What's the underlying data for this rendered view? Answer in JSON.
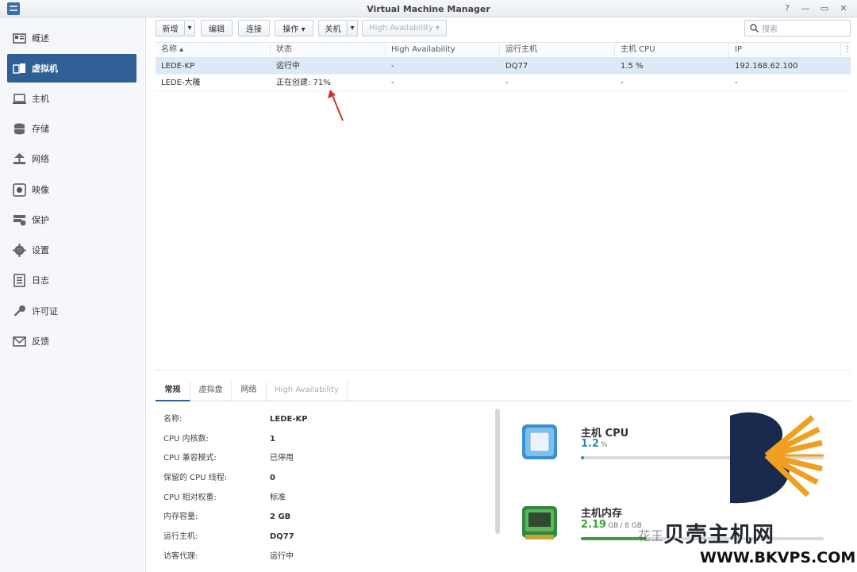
{
  "window": {
    "title": "Virtual Machine Manager"
  },
  "sidebar": {
    "items": [
      {
        "label": "概述",
        "icon": "overview-icon"
      },
      {
        "label": "虚拟机",
        "icon": "vm-icon",
        "active": true
      },
      {
        "label": "主机",
        "icon": "host-icon"
      },
      {
        "label": "存储",
        "icon": "storage-icon"
      },
      {
        "label": "网络",
        "icon": "network-icon"
      },
      {
        "label": "映像",
        "icon": "image-icon"
      },
      {
        "label": "保护",
        "icon": "protection-icon"
      },
      {
        "label": "设置",
        "icon": "settings-icon"
      },
      {
        "label": "日志",
        "icon": "log-icon"
      },
      {
        "label": "许可证",
        "icon": "license-icon"
      },
      {
        "label": "反馈",
        "icon": "feedback-icon"
      }
    ]
  },
  "toolbar": {
    "new_label": "新增",
    "edit_label": "编辑",
    "connect_label": "连接",
    "action_label": "操作 ▾",
    "shutdown_label": "关机",
    "ha_label": "High Availability ▾",
    "search_placeholder": "搜索"
  },
  "grid": {
    "columns": [
      "名称 ▴",
      "状态",
      "High Availability",
      "运行主机",
      "主机 CPU",
      "IP"
    ],
    "rows": [
      {
        "name": "LEDE-KP",
        "status": "运行中",
        "ha": "-",
        "host": "DQ77",
        "cpu": "1.5 %",
        "ip": "192.168.62.100",
        "selected": true
      },
      {
        "name": "LEDE-大雕",
        "status": "正在创建: 71%",
        "ha": "-",
        "host": "-",
        "cpu": "-",
        "ip": "-",
        "selected": false
      }
    ]
  },
  "tabs": [
    "常规",
    "虚拟盘",
    "网络",
    "High Availability"
  ],
  "details": [
    {
      "label": "名称:",
      "value": "LEDE-KP",
      "bold": true
    },
    {
      "label": "CPU 内核数:",
      "value": "1",
      "bold": true
    },
    {
      "label": "CPU 兼容模式:",
      "value": "已停用",
      "bold": false
    },
    {
      "label": "保留的 CPU 线程:",
      "value": "0",
      "bold": true
    },
    {
      "label": "CPU 相对权重:",
      "value": "标准",
      "bold": false
    },
    {
      "label": "内存容量:",
      "value": "2 GB",
      "bold": true
    },
    {
      "label": "运行主机:",
      "value": "DQ77",
      "bold": true
    },
    {
      "label": "访客代理:",
      "value": "运行中",
      "bold": false
    }
  ],
  "resources": {
    "cpu": {
      "title": "主机 CPU",
      "value": "1.2",
      "unit": "%",
      "fraction": 0.012,
      "color": "#2f8bb6"
    },
    "memory": {
      "title": "主机内存",
      "value": "2.19",
      "unit": "GB",
      "total": "/ 8 GB",
      "fraction": 0.27,
      "color": "#3aa33a"
    }
  },
  "watermark": {
    "brand_cn": "贝壳主机网",
    "url": "WWW.BKVPS.COM",
    "small": "花王"
  },
  "colors": {
    "accent": "#2f5f94",
    "green": "#3c9a32",
    "selected_row": "#dce9f7"
  }
}
